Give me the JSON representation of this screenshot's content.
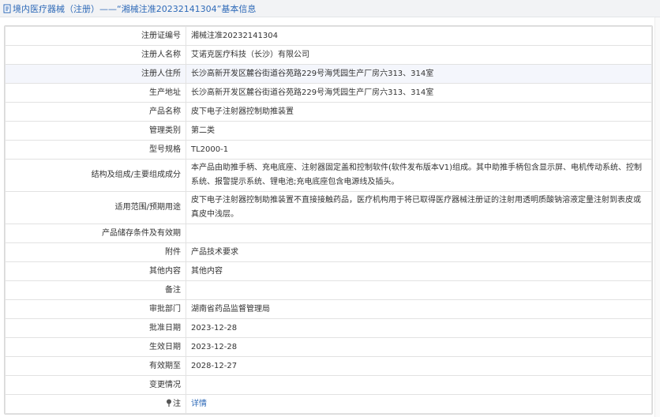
{
  "header": {
    "title": "境内医疗器械（注册）——“湘械注准20232141304”基本信息",
    "link_color": "#2e6ab8"
  },
  "rows": [
    {
      "label": "注册证编号",
      "value": "湘械注准20232141304"
    },
    {
      "label": "注册人名称",
      "value": "艾诺克医疗科技（长沙）有限公司"
    },
    {
      "label": "注册人住所",
      "value": "长沙高新开发区麓谷街道谷苑路229号海凭园生产厂房六313、314室"
    },
    {
      "label": "生产地址",
      "value": "长沙高新开发区麓谷街道谷苑路229号海凭园生产厂房六313、314室"
    },
    {
      "label": "产品名称",
      "value": "皮下电子注射器控制助推装置"
    },
    {
      "label": "管理类别",
      "value": "第二类"
    },
    {
      "label": "型号规格",
      "value": "TL2000-1"
    },
    {
      "label": "结构及组成/主要组成成分",
      "value": "本产品由助推手柄、充电底座、注射器固定盖和控制软件(软件发布版本V1)组成。其中助推手柄包含显示屏、电机传动系统、控制系统、报警提示系统、锂电池;充电底座包含电源线及插头。"
    },
    {
      "label": "适用范围/预期用途",
      "value": "皮下电子注射器控制助推装置不直接接触药品，医疗机构用于将已取得医疗器械注册证的注射用透明质酸钠溶液定量注射到表皮或真皮中浅层。"
    },
    {
      "label": "产品储存条件及有效期",
      "value": ""
    },
    {
      "label": "附件",
      "value": "产品技术要求"
    },
    {
      "label": "其他内容",
      "value": "其他内容"
    },
    {
      "label": "备注",
      "value": ""
    },
    {
      "label": "审批部门",
      "value": "湖南省药品监督管理局"
    },
    {
      "label": "批准日期",
      "value": "2023-12-28"
    },
    {
      "label": "生效日期",
      "value": "2023-12-28"
    },
    {
      "label": "有效期至",
      "value": "2028-12-27"
    },
    {
      "label": "变更情况",
      "value": ""
    },
    {
      "label": "注",
      "value": "详情"
    }
  ]
}
